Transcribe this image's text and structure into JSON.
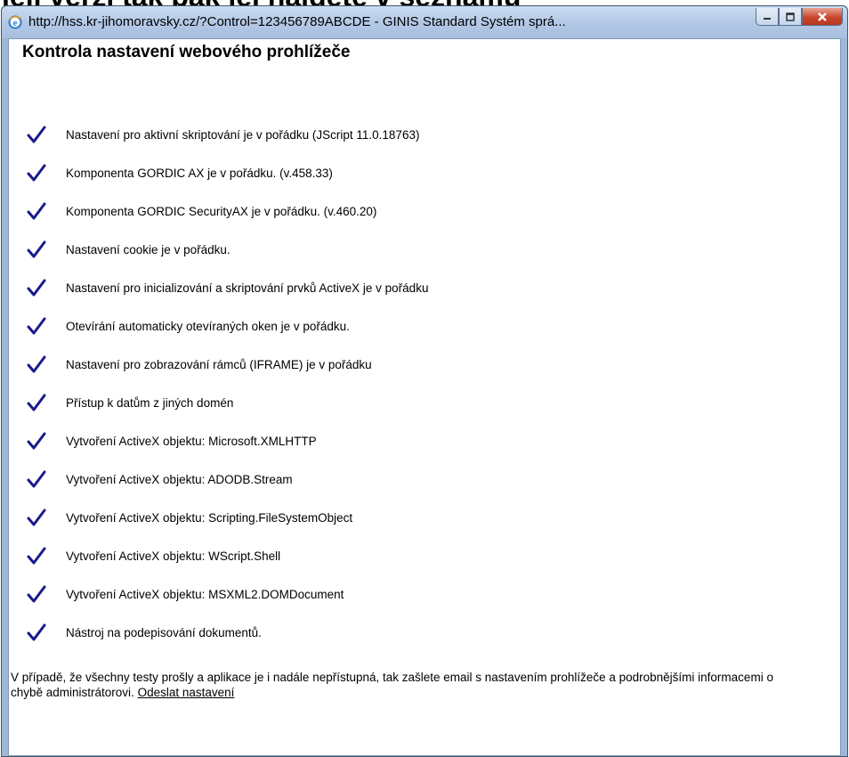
{
  "background_title": "jeji verzi tak pak jej najdete v seznamu",
  "window": {
    "title": "http://hss.kr-jihomoravsky.cz/?Control=123456789ABCDE - GINIS Standard Systém sprá...",
    "icon": "ie-icon",
    "buttons": {
      "minimize": "minimize",
      "maximize": "maximize",
      "close": "close"
    }
  },
  "page": {
    "heading": "Kontrola nastavení webového prohlížeče",
    "checks": [
      "Nastavení pro aktivní skriptování je v pořádku (JScript 11.0.18763)",
      "Komponenta GORDIC AX je v pořádku.  (v.458.33)",
      "Komponenta GORDIC SecurityAX je v pořádku.  (v.460.20)",
      "Nastavení cookie je v pořádku.",
      "Nastavení pro inicializování a skriptování prvků ActiveX je v pořádku",
      "Otevírání automaticky otevíraných oken je v pořádku.",
      "Nastavení pro zobrazování rámců (IFRAME) je v pořádku",
      "Přístup k datům z jiných domén",
      "Vytvoření ActiveX objektu: Microsoft.XMLHTTP",
      "Vytvoření ActiveX objektu: ADODB.Stream",
      "Vytvoření ActiveX objektu: Scripting.FileSystemObject",
      "Vytvoření ActiveX objektu: WScript.Shell",
      "Vytvoření ActiveX objektu: MSXML2.DOMDocument",
      "Nástroj na podepisování dokumentů."
    ],
    "footer_text": "V případě, že všechny testy prošly a aplikace je i nadále nepřístupná, tak zašlete email s nastavením prohlížeče a podrobnějšími informacemi o chybě administrátorovi.",
    "footer_link": "Odeslat nastavení"
  },
  "colors": {
    "check": "#1a1a8c",
    "titlebar": "#b4c9e6",
    "close": "#c9472e"
  }
}
